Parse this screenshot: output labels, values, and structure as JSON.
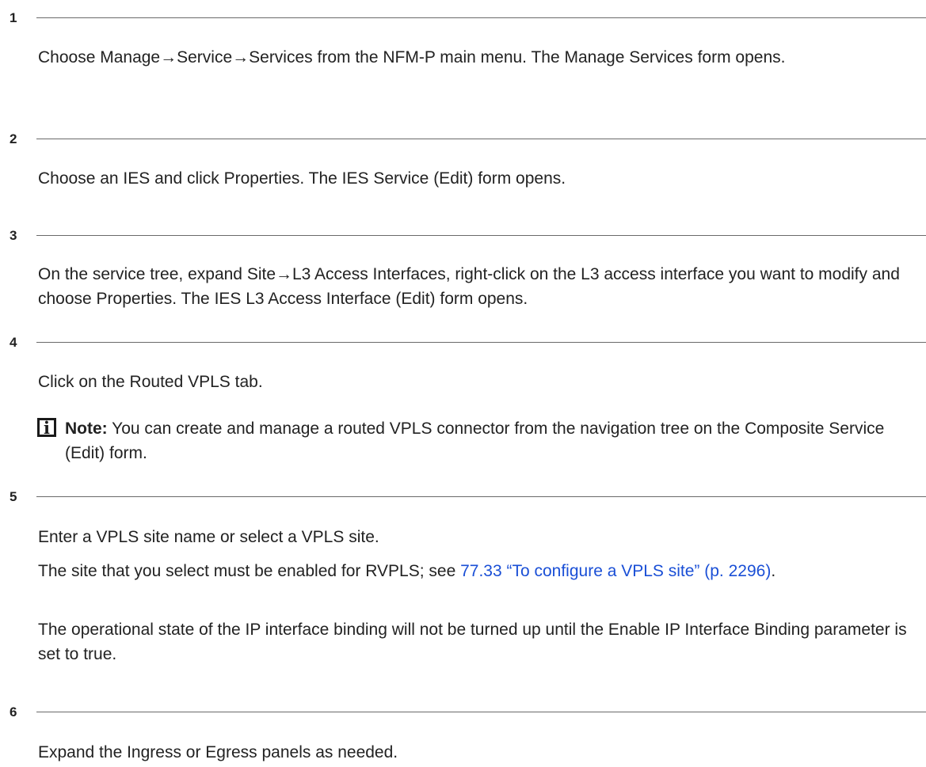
{
  "steps": [
    {
      "number": "1",
      "paragraphs": [
        "Choose Manage→Service→Services from the NFM-P main menu. The Manage Services form opens."
      ]
    },
    {
      "number": "2",
      "paragraphs": [
        "Choose an IES and click Properties. The IES Service (Edit) form opens."
      ]
    },
    {
      "number": "3",
      "paragraphs": [
        "On the service tree, expand Site→L3 Access Interfaces, right-click on the L3 access interface you want to modify and choose Properties. The IES L3 Access Interface (Edit) form opens."
      ]
    },
    {
      "number": "4",
      "paragraphs": [
        "Click on the Routed VPLS tab."
      ],
      "note": {
        "icon": "info-icon",
        "icon_glyph": "i",
        "label": "Note:",
        "text": "You can create and manage a routed VPLS connector from the navigation tree on the Composite Service (Edit) form."
      }
    },
    {
      "number": "5",
      "paragraphs": [
        "Enter a VPLS site name or select a VPLS site.",
        "The operational state of the IP interface binding will not be turned up until the Enable IP Interface Binding parameter is set to true."
      ],
      "cross_ref": {
        "prefix": "The site that you select must be enabled for RVPLS; see ",
        "link": "77.33 “To configure a VPLS site” (p. 2296)",
        "suffix": "."
      }
    },
    {
      "number": "6",
      "paragraphs": [
        "Expand the Ingress or Egress panels as needed."
      ]
    }
  ],
  "colors": {
    "text": "#222222",
    "link": "#1a4fd6",
    "rule": "#6a6a6a"
  }
}
